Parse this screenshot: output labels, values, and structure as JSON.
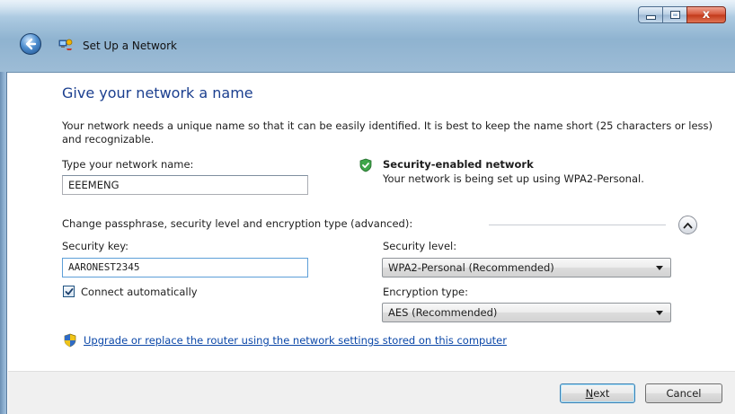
{
  "window": {
    "title": "Set Up a Network",
    "close_glyph": "x"
  },
  "page": {
    "heading": "Give your network a name",
    "description": "Your network needs a unique name so that it can be easily identified. It is best to keep the name short (25 characters or less) and recognizable."
  },
  "network_name": {
    "label": "Type your network name:",
    "value": "EEEMENG"
  },
  "security_status": {
    "title": "Security-enabled network",
    "subtitle": "Your network is being set up using WPA2-Personal.",
    "icon": "green-check-shield-icon"
  },
  "advanced": {
    "label": "Change passphrase, security level and encryption type (advanced):",
    "toggle_icon": "chevron-up-icon"
  },
  "security_key": {
    "label": "Security key:",
    "value": "AARONEST2345"
  },
  "security_level": {
    "label": "Security level:",
    "selected": "WPA2-Personal (Recommended)"
  },
  "encryption_type": {
    "label": "Encryption type:",
    "selected": "AES (Recommended)"
  },
  "connect_auto": {
    "label": "Connect automatically",
    "checked": true
  },
  "upgrade_link": {
    "text": "Upgrade or replace the router using the network settings stored on this computer",
    "icon": "uac-shield-icon"
  },
  "footer": {
    "next_label": "Next",
    "next_mnemonic": "N",
    "next_rest": "ext",
    "cancel_label": "Cancel"
  },
  "colors": {
    "heading": "#1b3f8f",
    "link": "#0b47a8",
    "close_button": "#c2391a"
  }
}
